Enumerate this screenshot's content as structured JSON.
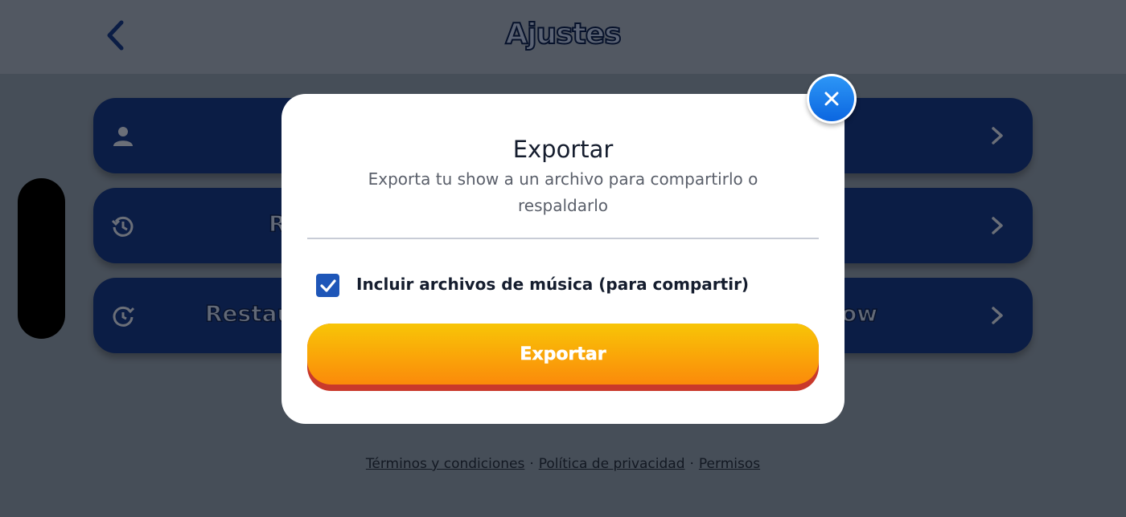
{
  "header": {
    "title": "Ajustes"
  },
  "rows": [
    {
      "label": ""
    },
    {
      "label": "R"
    },
    {
      "label_left": "Restau",
      "label_right": "ow"
    }
  ],
  "footer": {
    "terms": "Términos y condiciones",
    "privacy": "Política de privacidad",
    "permissions": "Permisos",
    "separator": "·"
  },
  "modal": {
    "title": "Exportar",
    "subtitle": "Exporta tu show a un archivo para compartirlo o respaldarlo",
    "include_music": {
      "label": "Incluir archivos de música (para compartir)",
      "checked": true
    },
    "export_button": "Exportar"
  },
  "colors": {
    "row_bg": "#173a8a",
    "accent_blue": "#1e56b8",
    "button_orange_top": "#f8c507",
    "button_orange_bottom": "#fb8a0a",
    "button_shadow": "#c9392b"
  },
  "icons": [
    "back-chevron-icon",
    "person-icon",
    "history-icon",
    "restore-icon",
    "chevron-right-icon",
    "close-icon",
    "checkmark-icon"
  ]
}
